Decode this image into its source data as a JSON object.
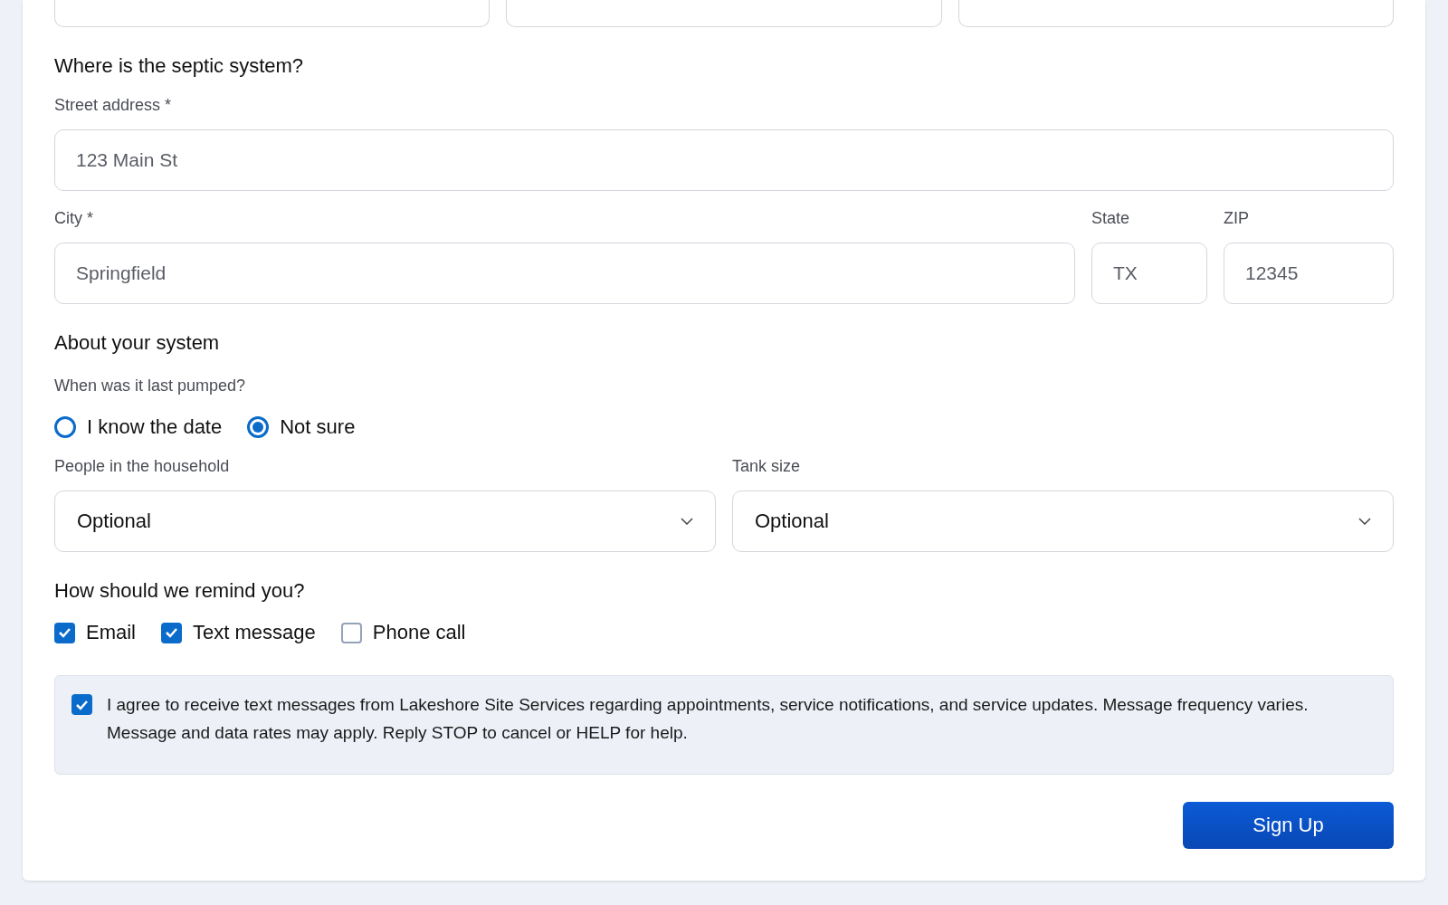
{
  "contact_fields": [
    {
      "kind": "input"
    },
    {
      "kind": "input"
    },
    {
      "kind": "input"
    }
  ],
  "location": {
    "heading": "Where is the septic system?",
    "street": {
      "label": "Street address *",
      "placeholder": "123 Main St"
    },
    "city": {
      "label": "City *",
      "placeholder": "Springfield"
    },
    "state": {
      "label": "State",
      "placeholder": "TX"
    },
    "zip": {
      "label": "ZIP",
      "placeholder": "12345"
    }
  },
  "system": {
    "heading": "About your system",
    "question": "When was it last pumped?",
    "options": [
      {
        "label": "I know the date",
        "selected": false
      },
      {
        "label": "Not sure",
        "selected": true
      }
    ],
    "selects": [
      {
        "label": "People in the household",
        "value": "Optional"
      },
      {
        "label": "Tank size",
        "value": "Optional"
      }
    ]
  },
  "reminders": {
    "heading": "How should we remind you?",
    "options": [
      {
        "label": "Email",
        "checked": true
      },
      {
        "label": "Text message",
        "checked": true
      },
      {
        "label": "Phone call",
        "checked": false
      }
    ]
  },
  "consent": {
    "checked": true,
    "text": "I agree to receive text messages from Lakeshore Site Services regarding appointments, service notifications, and service updates. Message frequency varies. Message and data rates may apply. Reply STOP to cancel or HELP for help."
  },
  "submit": "Sign Up"
}
